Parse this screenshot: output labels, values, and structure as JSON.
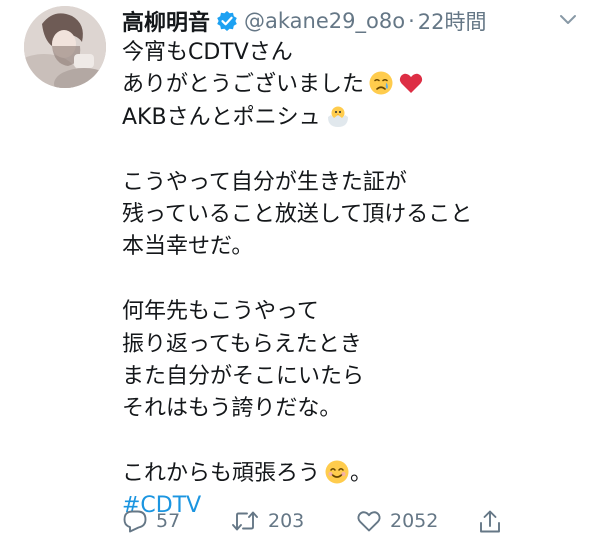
{
  "tweet": {
    "author": {
      "display_name": "高柳明音",
      "handle": "@akane29_o8o",
      "verified": true
    },
    "separator": "·",
    "time": "22時間",
    "lines": [
      "今宵もCDTVさん",
      "ありがとうございました",
      "AKBさんとポニシュ",
      "",
      "こうやって自分が生きた証が",
      "残っていること放送して頂けること",
      "本当幸せだ。",
      "",
      "何年先もこうやって",
      "振り返ってもらえたとき",
      "また自分がそこにいたら",
      "それはもう誇りだな。",
      "",
      "これからも頑張ろう",
      "#CDTV"
    ],
    "line_13_suffix": "。",
    "emoji": {
      "line_1": [
        "crying-face",
        "red-heart"
      ],
      "line_2": [
        "hatching-chick"
      ],
      "line_13": [
        "smiling-face"
      ]
    },
    "actions": {
      "replies": "57",
      "retweets": "203",
      "likes": "2052"
    },
    "colors": {
      "text": "#14171a",
      "muted": "#657786",
      "link": "#1b95e0",
      "verified": "#1da1f2"
    }
  }
}
